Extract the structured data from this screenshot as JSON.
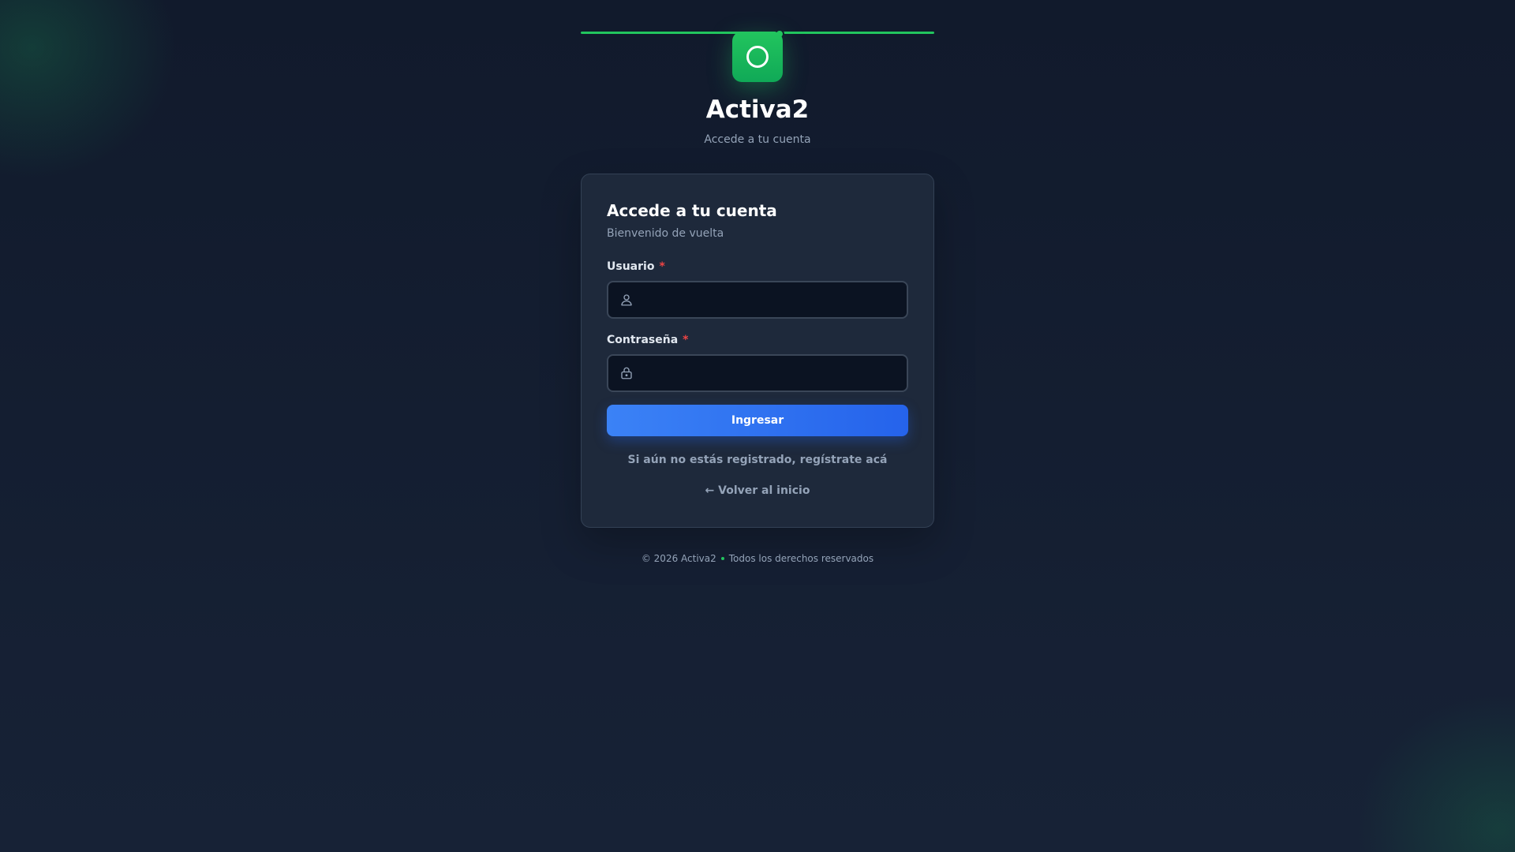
{
  "brand": {
    "name": "Activa2",
    "tagline": "Accede a tu cuenta",
    "logo_icon": "circle-ring-icon",
    "accent_color": "#22c55e"
  },
  "card": {
    "title": "Accede a tu cuenta",
    "subtitle": "Bienvenido de vuelta"
  },
  "form": {
    "username": {
      "label": "Usuario",
      "required_mark": "*",
      "value": "",
      "icon": "user-icon"
    },
    "password": {
      "label": "Contraseña",
      "required_mark": "*",
      "value": "",
      "icon": "lock-icon"
    },
    "submit_label": "Ingresar",
    "submit_color": "#3b82f6"
  },
  "links": {
    "register": "Si aún no estás registrado, regístrate acá",
    "back": "← Volver al inicio"
  },
  "footer": {
    "copyright": "© 2026 Activa2",
    "rights": "Todos los derechos reservados"
  }
}
